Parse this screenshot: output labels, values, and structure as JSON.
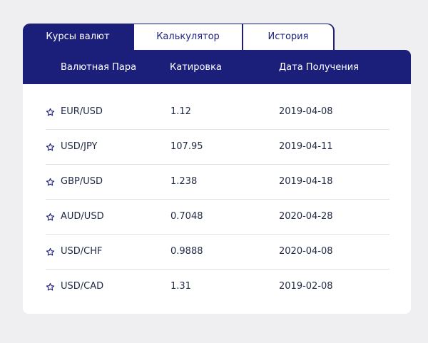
{
  "tabs": [
    {
      "label": "Курсы валют",
      "active": true
    },
    {
      "label": "Калькулятор",
      "active": false
    },
    {
      "label": "История",
      "active": false
    }
  ],
  "table": {
    "headers": [
      "Валютная Пара",
      "Катировка",
      "Дата Получения"
    ],
    "rows": [
      {
        "pair": "EUR/USD",
        "rate": "1.12",
        "date": "2019-04-08"
      },
      {
        "pair": "USD/JPY",
        "rate": "107.95",
        "date": "2019-04-11"
      },
      {
        "pair": "GBP/USD",
        "rate": "1.238",
        "date": "2019-04-18"
      },
      {
        "pair": "AUD/USD",
        "rate": "0.7048",
        "date": "2020-04-28"
      },
      {
        "pair": "USD/CHF",
        "rate": "0.9888",
        "date": "2020-04-08"
      },
      {
        "pair": "USD/CAD",
        "rate": "1.31",
        "date": "2019-02-08"
      }
    ]
  },
  "icons": {
    "favorite": "star-outline-icon"
  },
  "colors": {
    "accent": "#1b1f7a",
    "background": "#efeef0",
    "divider": "#e1e2ea"
  }
}
